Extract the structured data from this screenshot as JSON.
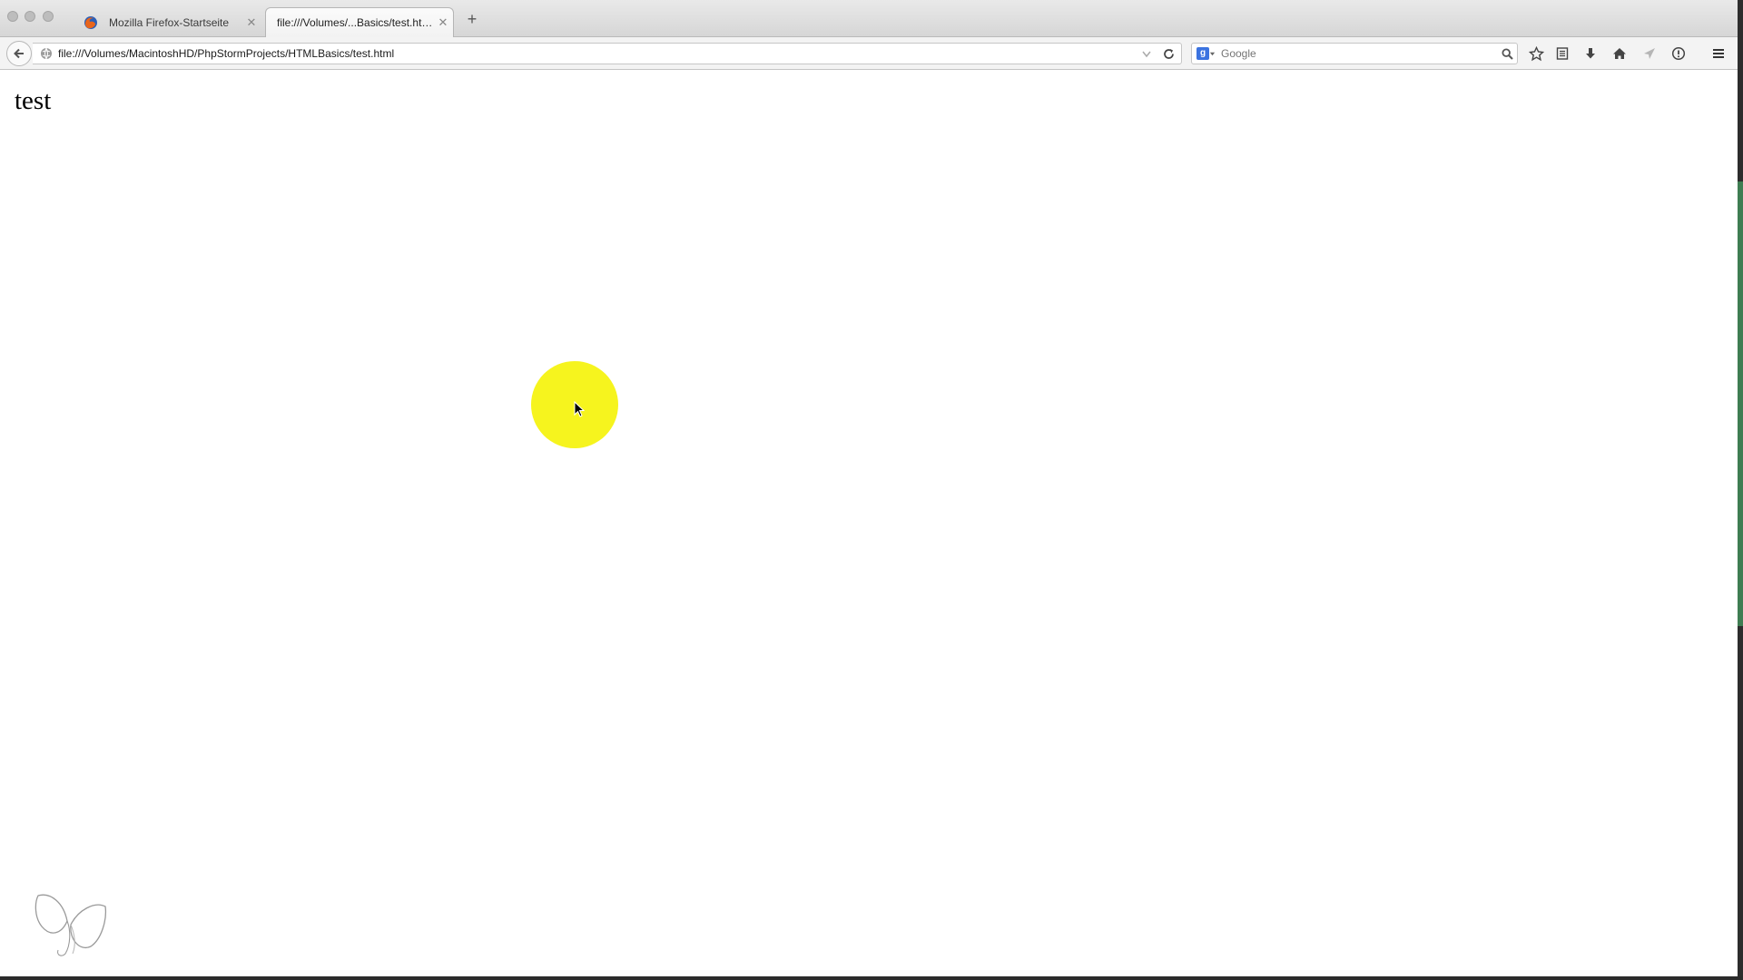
{
  "tabs": [
    {
      "title": "Mozilla Firefox-Startseite",
      "active": false
    },
    {
      "title": "file:///Volumes/...Basics/test.html",
      "active": true
    }
  ],
  "nav": {
    "url": "file:///Volumes/MacintoshHD/PhpStormProjects/HTMLBasics/test.html",
    "search_placeholder": "Google",
    "search_engine_icon": "google-icon"
  },
  "toolbar_icons": [
    "bookmark-star-icon",
    "reading-list-icon",
    "download-icon",
    "home-icon",
    "send-icon",
    "info-icon",
    "menu-icon"
  ],
  "page": {
    "heading": "test"
  },
  "colors": {
    "highlight": "#f6f41e",
    "accent_green": "#3f7d52"
  }
}
